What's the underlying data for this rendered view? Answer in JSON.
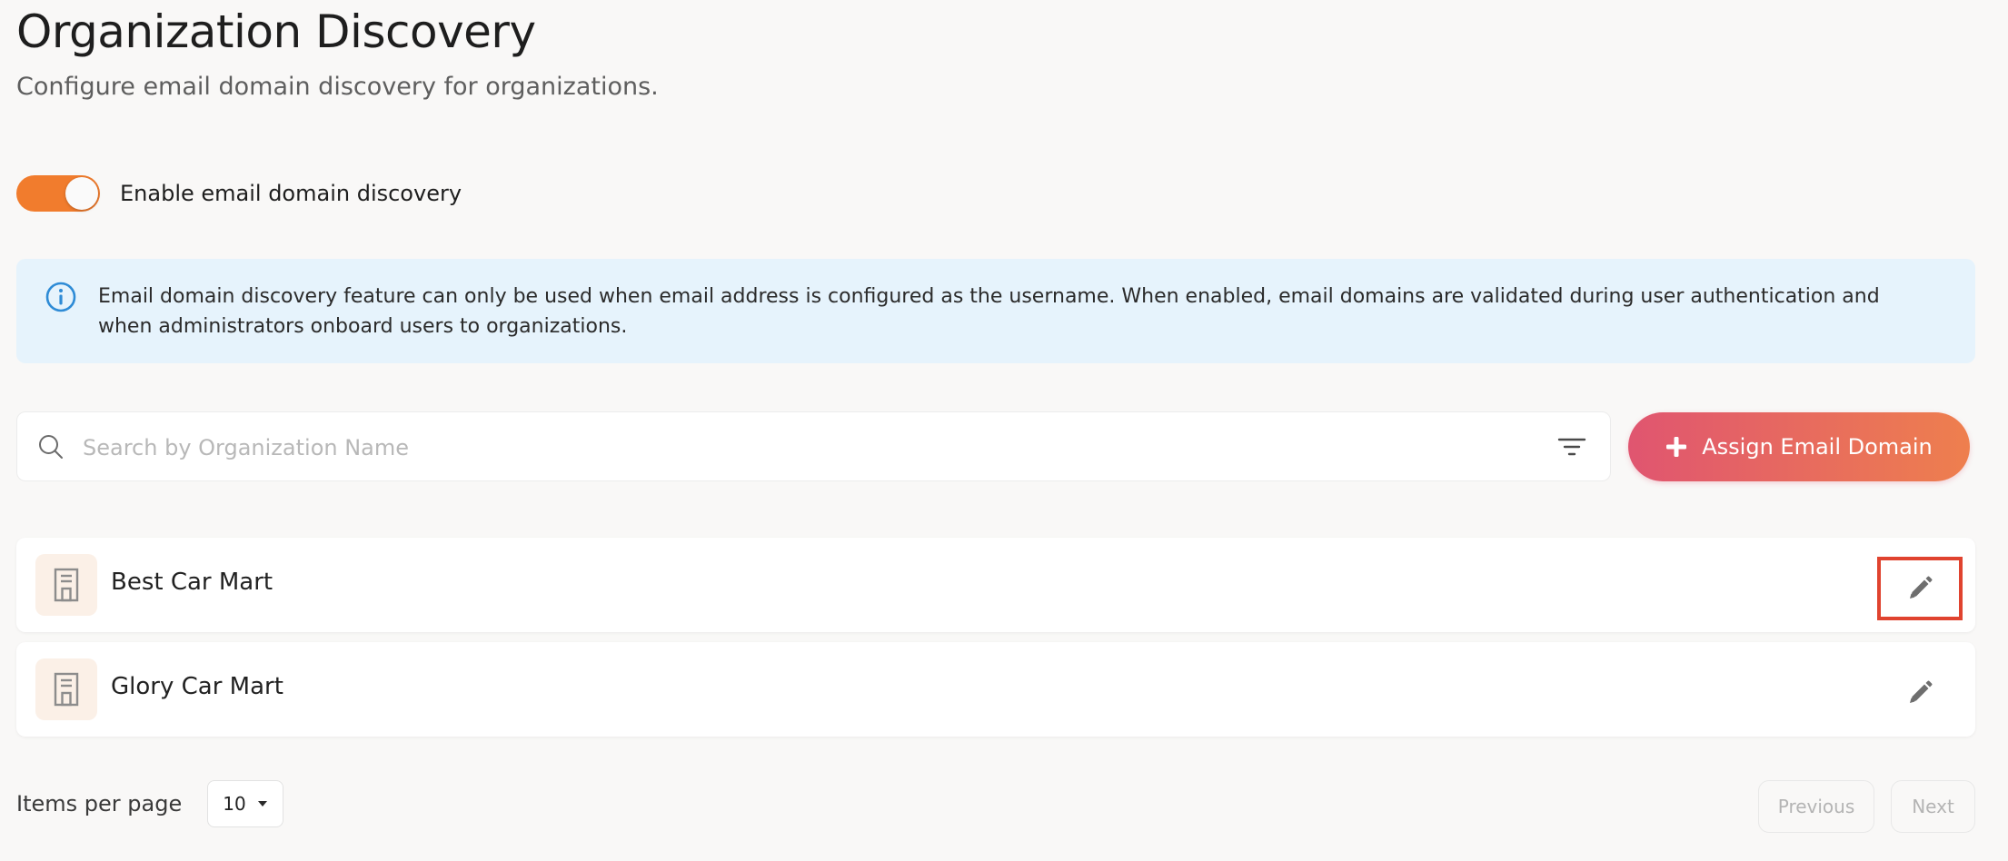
{
  "header": {
    "title": "Organization Discovery",
    "subtitle": "Configure email domain discovery for organizations."
  },
  "discovery_toggle": {
    "label": "Enable email domain discovery",
    "enabled": true,
    "color": "#f17c2d"
  },
  "info_banner": {
    "icon": "info-icon",
    "text": "Email domain discovery feature can only be used when email address is configured as the username. When enabled, email domains are validated during user authentication and when administrators onboard users to organizations."
  },
  "search": {
    "placeholder": "Search by Organization Name",
    "value": "",
    "icon": "search-icon",
    "filter_icon": "filter-icon"
  },
  "assign_button": {
    "label": "Assign Email Domain",
    "icon": "plus-icon",
    "gradient": [
      "#e05570",
      "#ee7f4e"
    ]
  },
  "organizations": [
    {
      "name": "Best Car Mart",
      "icon": "building-icon",
      "action_icon": "pencil-icon",
      "highlighted": true
    },
    {
      "name": "Glory Car Mart",
      "icon": "building-icon",
      "action_icon": "pencil-icon",
      "highlighted": false
    }
  ],
  "pagination": {
    "items_per_page_label": "Items per page",
    "items_per_page_value": "10",
    "previous_label": "Previous",
    "next_label": "Next"
  }
}
